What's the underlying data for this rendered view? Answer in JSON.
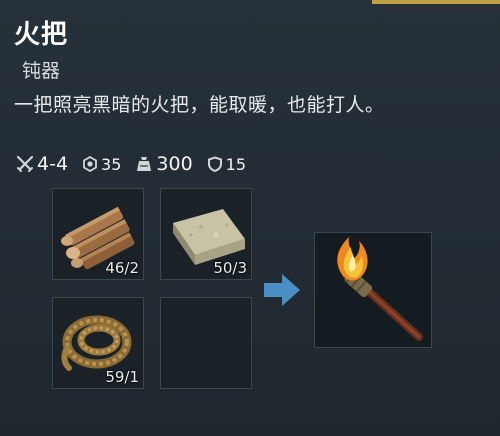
{
  "item": {
    "name": "火把",
    "type": "钝器",
    "description": "一把照亮黑暗的火把，能取暖，也能打人。"
  },
  "stats": {
    "damage": "4-4",
    "defense": "35",
    "weight": "300",
    "durability": "15"
  },
  "recipe": {
    "ingredients": [
      {
        "icon": "wood-logs-icon",
        "count": "46/2"
      },
      {
        "icon": "stone-block-icon",
        "count": "50/3"
      },
      {
        "icon": "rope-coil-icon",
        "count": "59/1"
      },
      {
        "icon": "empty-slot",
        "count": ""
      }
    ],
    "result_icon": "torch-icon",
    "arrow_icon": "right-arrow-icon"
  },
  "colors": {
    "accent": "#d8b44a",
    "arrow": "#4a8fc4",
    "flame": "#f5a623"
  }
}
